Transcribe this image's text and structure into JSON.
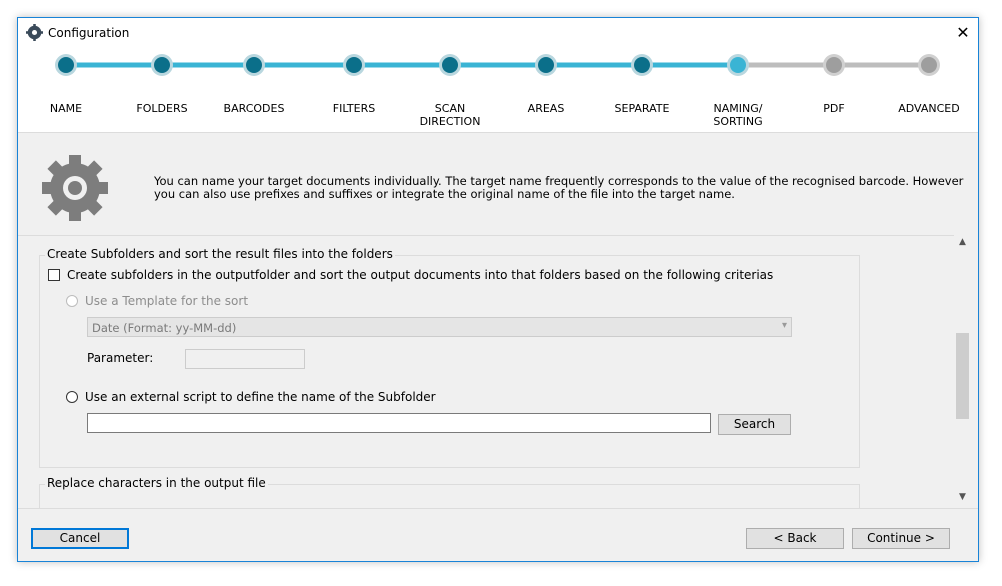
{
  "window": {
    "title": "Configuration",
    "close_glyph": "✕",
    "app_icon": "gear-icon"
  },
  "steps": [
    {
      "label": "NAME",
      "state": "done"
    },
    {
      "label": "FOLDERS",
      "state": "done"
    },
    {
      "label": "BARCODES",
      "state": "done"
    },
    {
      "label": "FILTERS",
      "state": "done"
    },
    {
      "label": "SCAN\nDIRECTION",
      "state": "done"
    },
    {
      "label": "AREAS",
      "state": "done"
    },
    {
      "label": "SEPARATE",
      "state": "done"
    },
    {
      "label": "NAMING/\nSORTING",
      "state": "current"
    },
    {
      "label": "PDF",
      "state": "todo"
    },
    {
      "label": "ADVANCED",
      "state": "todo"
    }
  ],
  "colors": {
    "accent": "#3ab4d4",
    "accent_dark": "#0b6f8a",
    "inactive": "#bdbdbd",
    "focus": "#0078d7"
  },
  "info": {
    "icon": "gear-icon",
    "text": "You can name your target documents individually. The target name frequently corresponds to the value of the recognised barcode. However you can also use prefixes and suffixes or integrate the original name of the file into the target name."
  },
  "subfolders": {
    "legend": "Create Subfolders and sort the result files into the folders",
    "create_checkbox_label": "Create subfolders in the outputfolder and sort the output documents into that folders based on the following criterias",
    "create_checked": false,
    "template_radio_label": "Use a Template for the sort",
    "template_value": "Date (Format: yy-MM-dd)",
    "parameter_label": "Parameter:",
    "parameter_value": "",
    "script_radio_label": "Use an external script to define the name of the Subfolder",
    "script_value": "",
    "search_label": "Search"
  },
  "replace": {
    "legend": "Replace characters in the output file"
  },
  "footer": {
    "cancel_label": "Cancel",
    "back_label": "< Back",
    "continue_label": "Continue >"
  }
}
